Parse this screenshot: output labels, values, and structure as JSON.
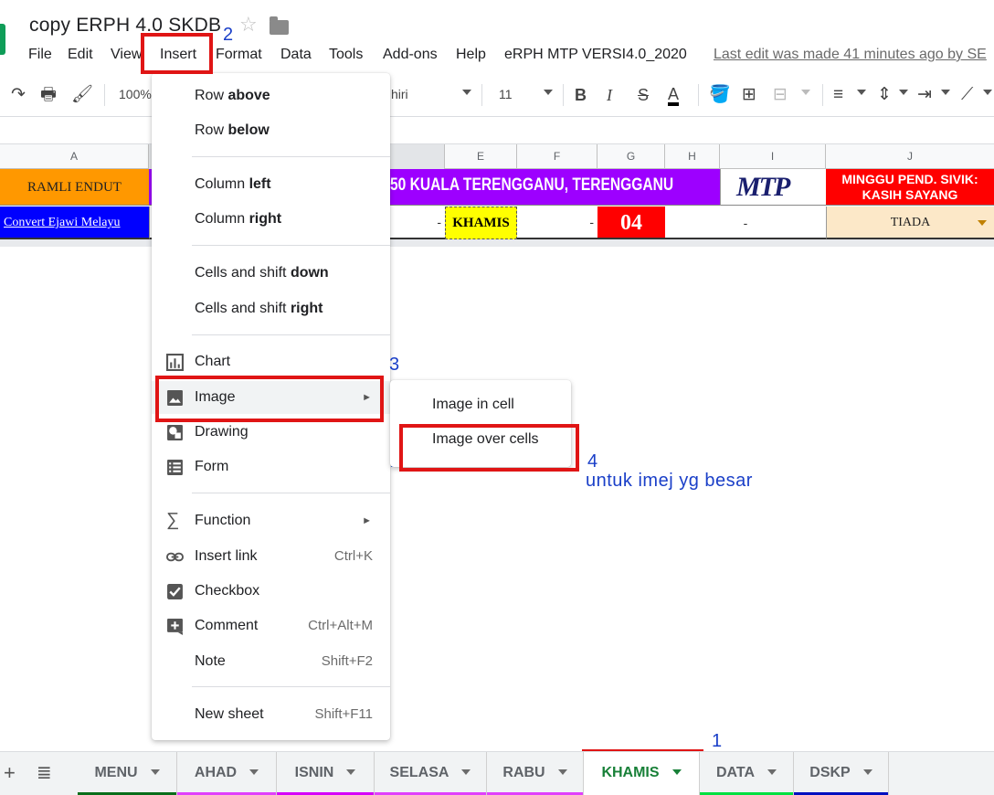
{
  "title": {
    "doc_name": "copy  ERPH 4.0 SKDB"
  },
  "menubar": {
    "items": [
      "File",
      "Edit",
      "View",
      "Insert",
      "Format",
      "Data",
      "Tools",
      "Add-ons",
      "Help",
      "eRPH MTP VERSI4.0_2020"
    ],
    "last_edit": "Last edit was made 41 minutes ago by SE"
  },
  "toolbar": {
    "zoom": "100%",
    "font": "hiri",
    "font_size": "11",
    "bold": "B",
    "italic": "I",
    "strike": "S",
    "text_color": "A"
  },
  "grid": {
    "columns": [
      "A",
      "E",
      "F",
      "G",
      "H",
      "I",
      "J"
    ],
    "row1": {
      "a": "RAMLI ENDUT",
      "banner": "50 KUALA TERENGGANU, TERENGGANU",
      "logo": "MTP",
      "j": "MINGGU PEND. SIVIK: KASIH SAYANG"
    },
    "row2": {
      "a": "Convert Ejawi Melayu",
      "d": "-",
      "e": "KHAMIS",
      "f": "-",
      "g": "04",
      "hi": "-",
      "j": "TIADA"
    }
  },
  "insert_menu": {
    "row_above_1": "Row ",
    "row_above_2": "above",
    "row_below_1": "Row ",
    "row_below_2": "below",
    "col_left_1": "Column ",
    "col_left_2": "left",
    "col_right_1": "Column ",
    "col_right_2": "right",
    "shift_down_1": "Cells and shift ",
    "shift_down_2": "down",
    "shift_right_1": "Cells and shift ",
    "shift_right_2": "right",
    "chart": "Chart",
    "image": "Image",
    "drawing": "Drawing",
    "form": "Form",
    "function": "Function",
    "insert_link": "Insert link",
    "insert_link_sc": "Ctrl+K",
    "checkbox": "Checkbox",
    "comment": "Comment",
    "comment_sc": "Ctrl+Alt+M",
    "note": "Note",
    "note_sc": "Shift+F2",
    "new_sheet": "New sheet",
    "new_sheet_sc": "Shift+F11"
  },
  "image_submenu": {
    "in_cell": "Image in cell",
    "over_cells": "Image over cells"
  },
  "annotations": {
    "step1": "1",
    "step2": "2",
    "step3": "3",
    "step4": "4",
    "note": "untuk imej yg besar"
  },
  "sheet_tabs": [
    {
      "label": "MENU",
      "color": "#0a6e1a"
    },
    {
      "label": "AHAD",
      "color": "#e040fb"
    },
    {
      "label": "ISNIN",
      "color": "#d500f9"
    },
    {
      "label": "SELASA",
      "color": "#e040fb"
    },
    {
      "label": "RABU",
      "color": "#e040fb"
    },
    {
      "label": "KHAMIS",
      "color": "#1b5e20"
    },
    {
      "label": "DATA",
      "color": "#00e040"
    },
    {
      "label": "DSKP",
      "color": "#0010c0"
    }
  ],
  "colors": {
    "accent_red": "#e01515",
    "annotation_blue": "#1a3fc8",
    "banner_purple": "#9d00ff",
    "orange": "#ff9800",
    "yellow": "#ffff00",
    "red": "#ff0000"
  }
}
